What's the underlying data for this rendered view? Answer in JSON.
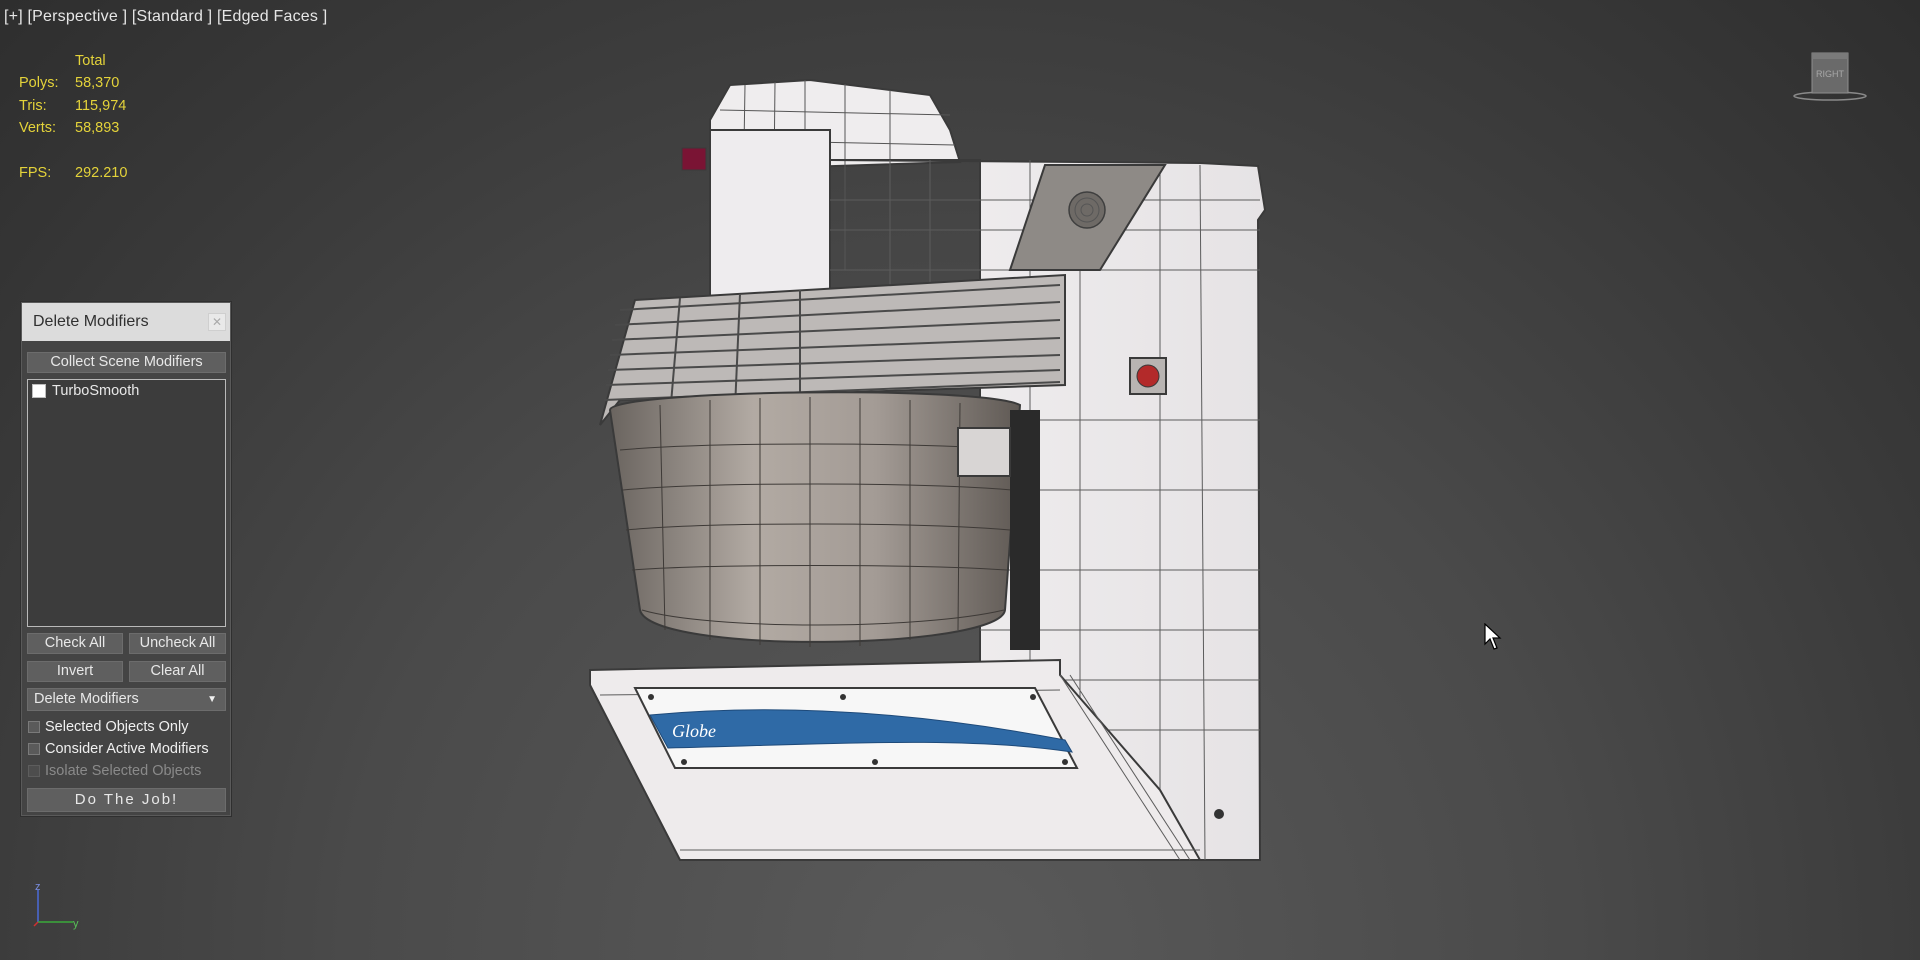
{
  "viewport": {
    "label": "[+] [Perspective ] [Standard ] [Edged Faces ]",
    "stats": {
      "header": "Total",
      "polys_label": "Polys:",
      "polys": "58,370",
      "tris_label": "Tris:",
      "tris": "115,974",
      "verts_label": "Verts:",
      "verts": "58,893",
      "fps_label": "FPS:",
      "fps": "292.210"
    },
    "viewcube_label": "RIGHT",
    "axis_labels": {
      "z": "z",
      "y": "y"
    },
    "model_logo_text": "Globe"
  },
  "panel": {
    "title": "Delete Modifiers",
    "close_icon": "close-icon",
    "collect_button": "Collect Scene Modifiers",
    "modifiers": [
      {
        "label": "TurboSmooth",
        "checked": false
      }
    ],
    "check_all": "Check All",
    "uncheck_all": "Uncheck All",
    "invert": "Invert",
    "clear_all": "Clear All",
    "mode_dropdown": "Delete Modifiers",
    "selected_objects_only": "Selected Objects Only",
    "consider_active_modifiers": "Consider Active Modifiers",
    "isolate_selected_objects": "Isolate Selected Objects",
    "do_the_job": "Do The Job!"
  },
  "colors": {
    "stats_text": "#e4d33a",
    "viewport_bg": "#4a4a4a",
    "logo_band": "#2f6aa6"
  }
}
